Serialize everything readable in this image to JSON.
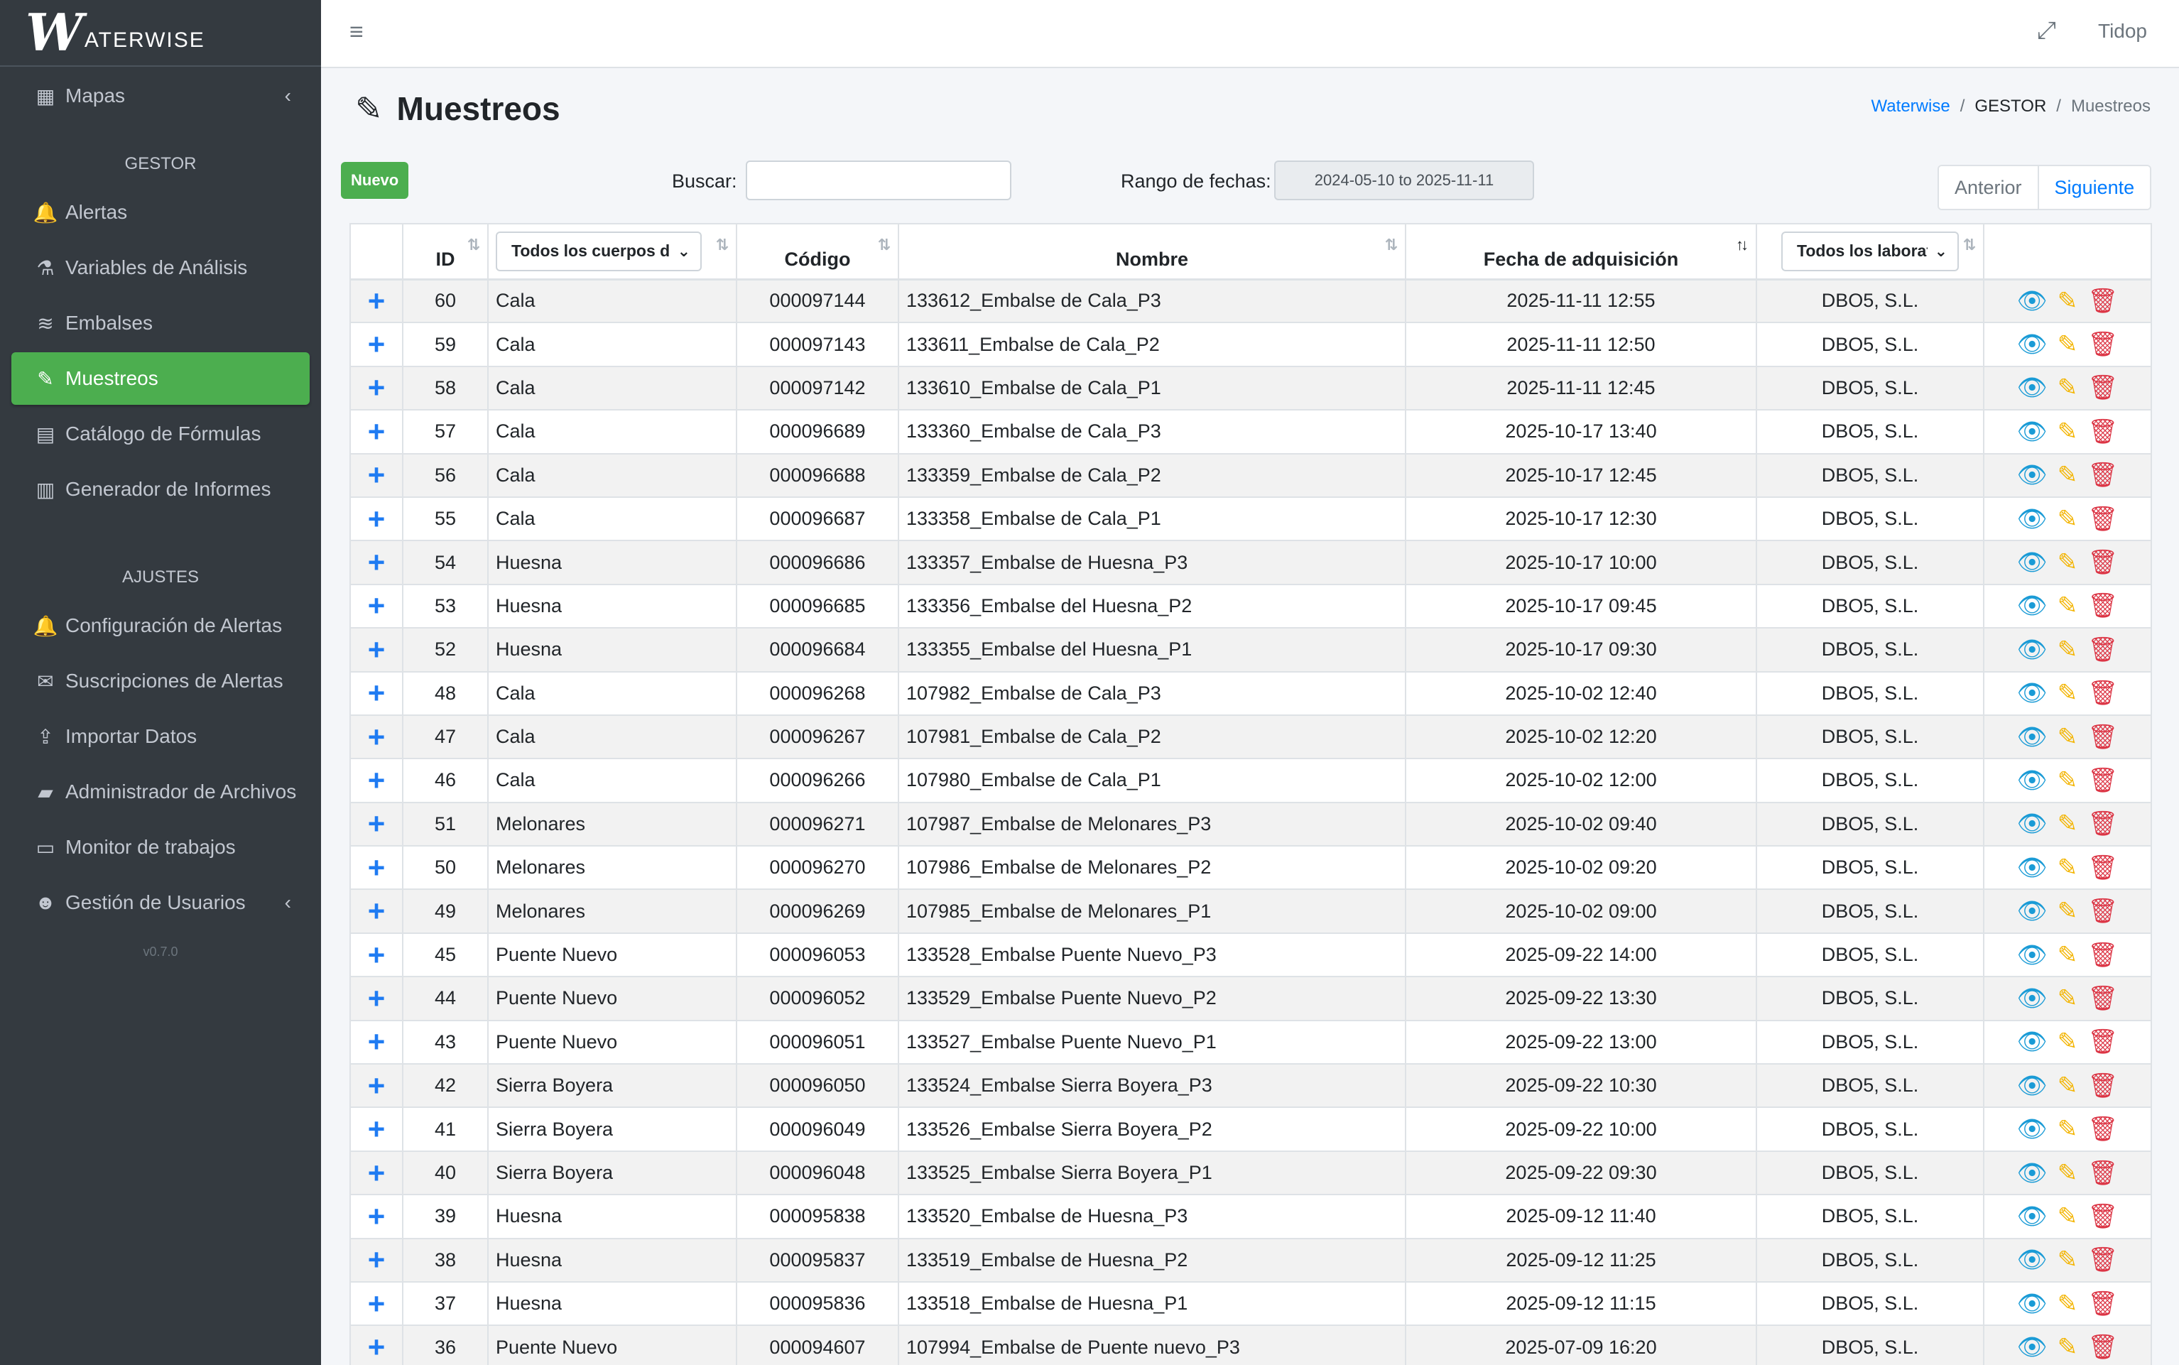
{
  "brand": {
    "mark": "W",
    "text": "ATERWISE"
  },
  "sidebar": {
    "items_top": [
      {
        "label": "Mapas",
        "icon": "map-icon",
        "glyph": "▦",
        "chevron": "‹"
      }
    ],
    "section_gestor": "GESTOR",
    "items_gestor": [
      {
        "label": "Alertas",
        "icon": "bell-icon",
        "glyph": "🔔"
      },
      {
        "label": "Variables de Análisis",
        "icon": "flask-icon",
        "glyph": "⚗"
      },
      {
        "label": "Embalses",
        "icon": "water-icon",
        "glyph": "≋"
      },
      {
        "label": "Muestreos",
        "icon": "eyedropper-icon",
        "glyph": "✎",
        "active": true
      },
      {
        "label": "Catálogo de Fórmulas",
        "icon": "calculator-icon",
        "glyph": "▤"
      },
      {
        "label": "Generador de Informes",
        "icon": "file-icon",
        "glyph": "▥"
      }
    ],
    "section_ajustes": "AJUSTES",
    "items_ajustes": [
      {
        "label": "Configuración de Alertas",
        "icon": "bell-icon",
        "glyph": "🔔"
      },
      {
        "label": "Suscripciones de Alertas",
        "icon": "envelope-icon",
        "glyph": "✉"
      },
      {
        "label": "Importar Datos",
        "icon": "upload-icon",
        "glyph": "⇪"
      },
      {
        "label": "Administrador de Archivos",
        "icon": "folder-open-icon",
        "glyph": "▰"
      },
      {
        "label": "Monitor de trabajos",
        "icon": "desktop-icon",
        "glyph": "▭"
      },
      {
        "label": "Gestión de Usuarios",
        "icon": "users-icon",
        "glyph": "☻",
        "chevron": "‹"
      }
    ],
    "version": "v0.7.0"
  },
  "topbar": {
    "menu_glyph": "≡",
    "expand_glyph": "⤢",
    "user": "Tidop"
  },
  "page": {
    "title": "Muestreos",
    "title_glyph": "✎",
    "breadcrumb": {
      "root": "Waterwise",
      "section": "GESTOR",
      "current": "Muestreos",
      "sep": "/"
    }
  },
  "toolbar": {
    "new_label": "Nuevo",
    "search_label": "Buscar:",
    "search_value": "",
    "date_label": "Rango de fechas:",
    "date_value": "2024-05-10 to 2025-11-11",
    "prev_label": "Anterior",
    "next_label": "Siguiente"
  },
  "table": {
    "headers": {
      "id": "ID",
      "cuerpo_select": "Todos los cuerpos de agua",
      "codigo": "Código",
      "nombre": "Nombre",
      "fecha": "Fecha de adquisición",
      "lab_select": "Todos los laboratorios"
    },
    "sort_glyph": "⇅",
    "sort_desc_glyph": "↑↓",
    "chev_glyph": "⌄",
    "expand_glyph": "+",
    "action_glyphs": {
      "view": "👁",
      "edit": "✎",
      "delete": "🗑"
    },
    "rows": [
      {
        "id": "60",
        "cuerpo": "Cala",
        "codigo": "000097144",
        "nombre": "133612_Embalse de Cala_P3",
        "fecha": "2025-11-11 12:55",
        "lab": "DBO5, S.L."
      },
      {
        "id": "59",
        "cuerpo": "Cala",
        "codigo": "000097143",
        "nombre": "133611_Embalse de Cala_P2",
        "fecha": "2025-11-11 12:50",
        "lab": "DBO5, S.L."
      },
      {
        "id": "58",
        "cuerpo": "Cala",
        "codigo": "000097142",
        "nombre": "133610_Embalse de Cala_P1",
        "fecha": "2025-11-11 12:45",
        "lab": "DBO5, S.L."
      },
      {
        "id": "57",
        "cuerpo": "Cala",
        "codigo": "000096689",
        "nombre": "133360_Embalse de Cala_P3",
        "fecha": "2025-10-17 13:40",
        "lab": "DBO5, S.L."
      },
      {
        "id": "56",
        "cuerpo": "Cala",
        "codigo": "000096688",
        "nombre": "133359_Embalse de Cala_P2",
        "fecha": "2025-10-17 12:45",
        "lab": "DBO5, S.L."
      },
      {
        "id": "55",
        "cuerpo": "Cala",
        "codigo": "000096687",
        "nombre": "133358_Embalse de Cala_P1",
        "fecha": "2025-10-17 12:30",
        "lab": "DBO5, S.L."
      },
      {
        "id": "54",
        "cuerpo": "Huesna",
        "codigo": "000096686",
        "nombre": "133357_Embalse de Huesna_P3",
        "fecha": "2025-10-17 10:00",
        "lab": "DBO5, S.L."
      },
      {
        "id": "53",
        "cuerpo": "Huesna",
        "codigo": "000096685",
        "nombre": "133356_Embalse del Huesna_P2",
        "fecha": "2025-10-17 09:45",
        "lab": "DBO5, S.L."
      },
      {
        "id": "52",
        "cuerpo": "Huesna",
        "codigo": "000096684",
        "nombre": "133355_Embalse del Huesna_P1",
        "fecha": "2025-10-17 09:30",
        "lab": "DBO5, S.L."
      },
      {
        "id": "48",
        "cuerpo": "Cala",
        "codigo": "000096268",
        "nombre": "107982_Embalse de Cala_P3",
        "fecha": "2025-10-02 12:40",
        "lab": "DBO5, S.L."
      },
      {
        "id": "47",
        "cuerpo": "Cala",
        "codigo": "000096267",
        "nombre": "107981_Embalse de Cala_P2",
        "fecha": "2025-10-02 12:20",
        "lab": "DBO5, S.L."
      },
      {
        "id": "46",
        "cuerpo": "Cala",
        "codigo": "000096266",
        "nombre": "107980_Embalse de Cala_P1",
        "fecha": "2025-10-02 12:00",
        "lab": "DBO5, S.L."
      },
      {
        "id": "51",
        "cuerpo": "Melonares",
        "codigo": "000096271",
        "nombre": "107987_Embalse de Melonares_P3",
        "fecha": "2025-10-02 09:40",
        "lab": "DBO5, S.L."
      },
      {
        "id": "50",
        "cuerpo": "Melonares",
        "codigo": "000096270",
        "nombre": "107986_Embalse de Melonares_P2",
        "fecha": "2025-10-02 09:20",
        "lab": "DBO5, S.L."
      },
      {
        "id": "49",
        "cuerpo": "Melonares",
        "codigo": "000096269",
        "nombre": "107985_Embalse de Melonares_P1",
        "fecha": "2025-10-02 09:00",
        "lab": "DBO5, S.L."
      },
      {
        "id": "45",
        "cuerpo": "Puente Nuevo",
        "codigo": "000096053",
        "nombre": "133528_Embalse Puente Nuevo_P3",
        "fecha": "2025-09-22 14:00",
        "lab": "DBO5, S.L."
      },
      {
        "id": "44",
        "cuerpo": "Puente Nuevo",
        "codigo": "000096052",
        "nombre": "133529_Embalse Puente Nuevo_P2",
        "fecha": "2025-09-22 13:30",
        "lab": "DBO5, S.L."
      },
      {
        "id": "43",
        "cuerpo": "Puente Nuevo",
        "codigo": "000096051",
        "nombre": "133527_Embalse Puente Nuevo_P1",
        "fecha": "2025-09-22 13:00",
        "lab": "DBO5, S.L."
      },
      {
        "id": "42",
        "cuerpo": "Sierra Boyera",
        "codigo": "000096050",
        "nombre": "133524_Embalse Sierra Boyera_P3",
        "fecha": "2025-09-22 10:30",
        "lab": "DBO5, S.L."
      },
      {
        "id": "41",
        "cuerpo": "Sierra Boyera",
        "codigo": "000096049",
        "nombre": "133526_Embalse Sierra Boyera_P2",
        "fecha": "2025-09-22 10:00",
        "lab": "DBO5, S.L."
      },
      {
        "id": "40",
        "cuerpo": "Sierra Boyera",
        "codigo": "000096048",
        "nombre": "133525_Embalse Sierra Boyera_P1",
        "fecha": "2025-09-22 09:30",
        "lab": "DBO5, S.L."
      },
      {
        "id": "39",
        "cuerpo": "Huesna",
        "codigo": "000095838",
        "nombre": "133520_Embalse de Huesna_P3",
        "fecha": "2025-09-12 11:40",
        "lab": "DBO5, S.L."
      },
      {
        "id": "38",
        "cuerpo": "Huesna",
        "codigo": "000095837",
        "nombre": "133519_Embalse de Huesna_P2",
        "fecha": "2025-09-12 11:25",
        "lab": "DBO5, S.L."
      },
      {
        "id": "37",
        "cuerpo": "Huesna",
        "codigo": "000095836",
        "nombre": "133518_Embalse de Huesna_P1",
        "fecha": "2025-09-12 11:15",
        "lab": "DBO5, S.L."
      },
      {
        "id": "36",
        "cuerpo": "Puente Nuevo",
        "codigo": "000094607",
        "nombre": "107994_Embalse de Puente nuevo_P3",
        "fecha": "2025-07-09 16:20",
        "lab": "DBO5, S.L."
      }
    ]
  }
}
